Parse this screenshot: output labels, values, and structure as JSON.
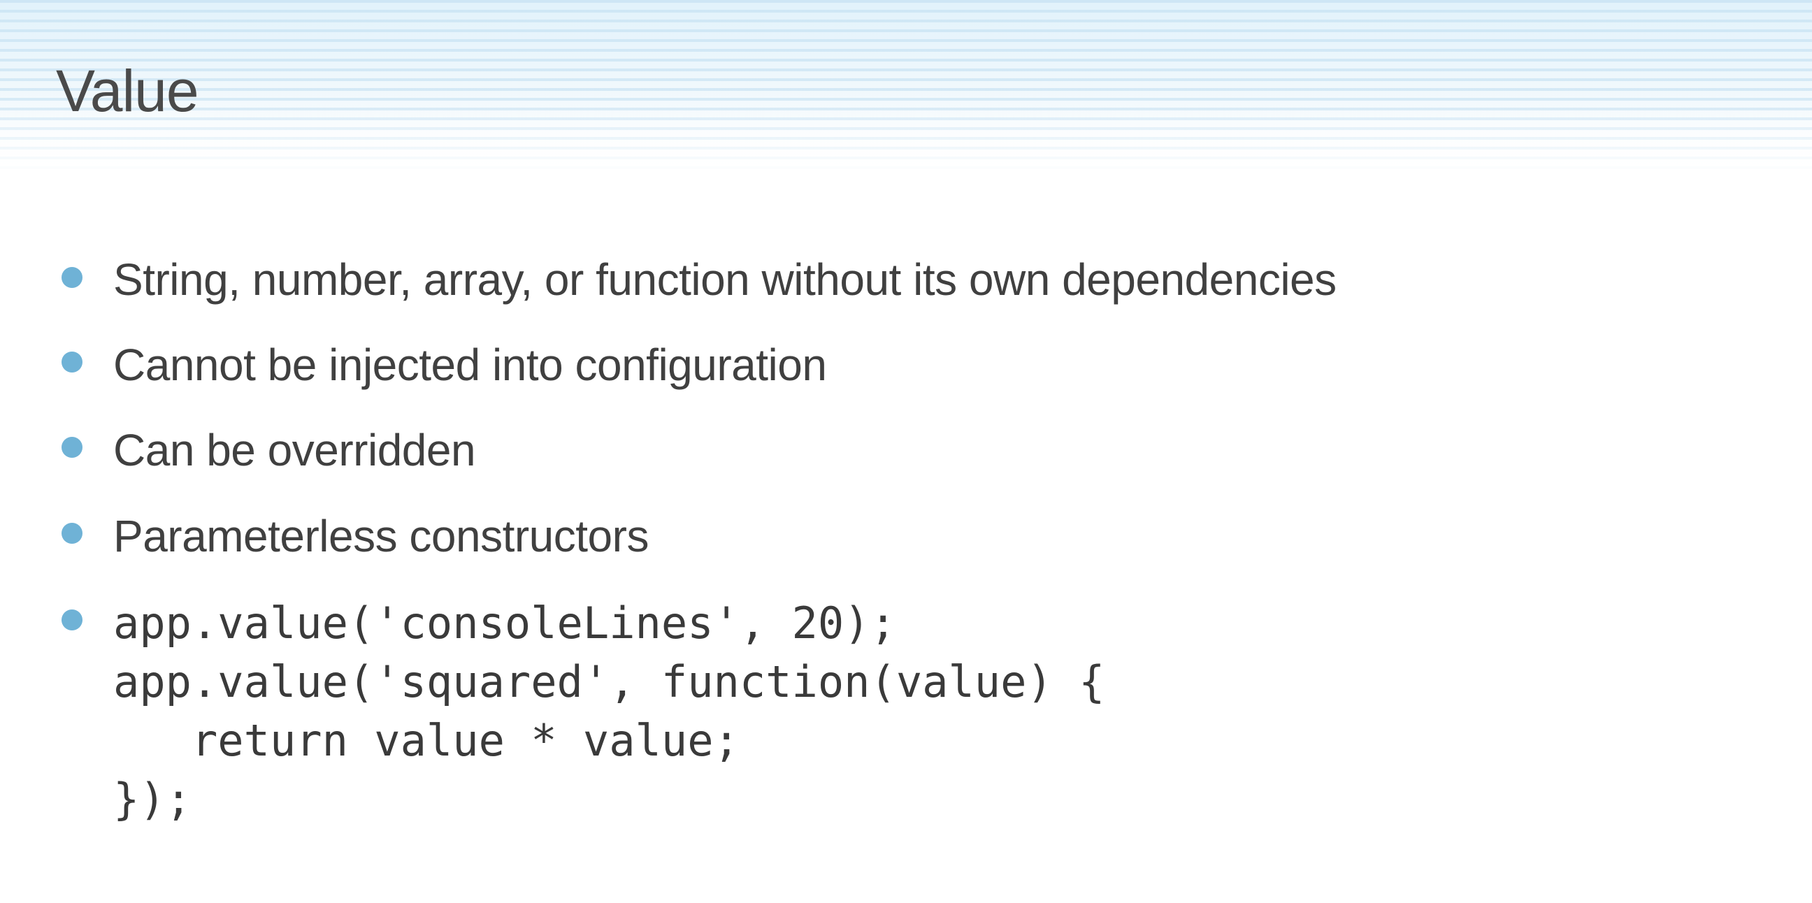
{
  "slide": {
    "title": "Value"
  },
  "bullets": [
    "String, number, array, or function without its own dependencies",
    "Cannot be injected into configuration",
    "Can be overridden",
    "Parameterless constructors"
  ],
  "code": {
    "lines": [
      "app.value('consoleLines', 20);",
      "app.value('squared', function(value) {",
      "   return value * value;",
      "});"
    ]
  },
  "colors": {
    "bullet": "#6fb2d6",
    "text": "#404040",
    "header_band": "#e1f2fb"
  }
}
